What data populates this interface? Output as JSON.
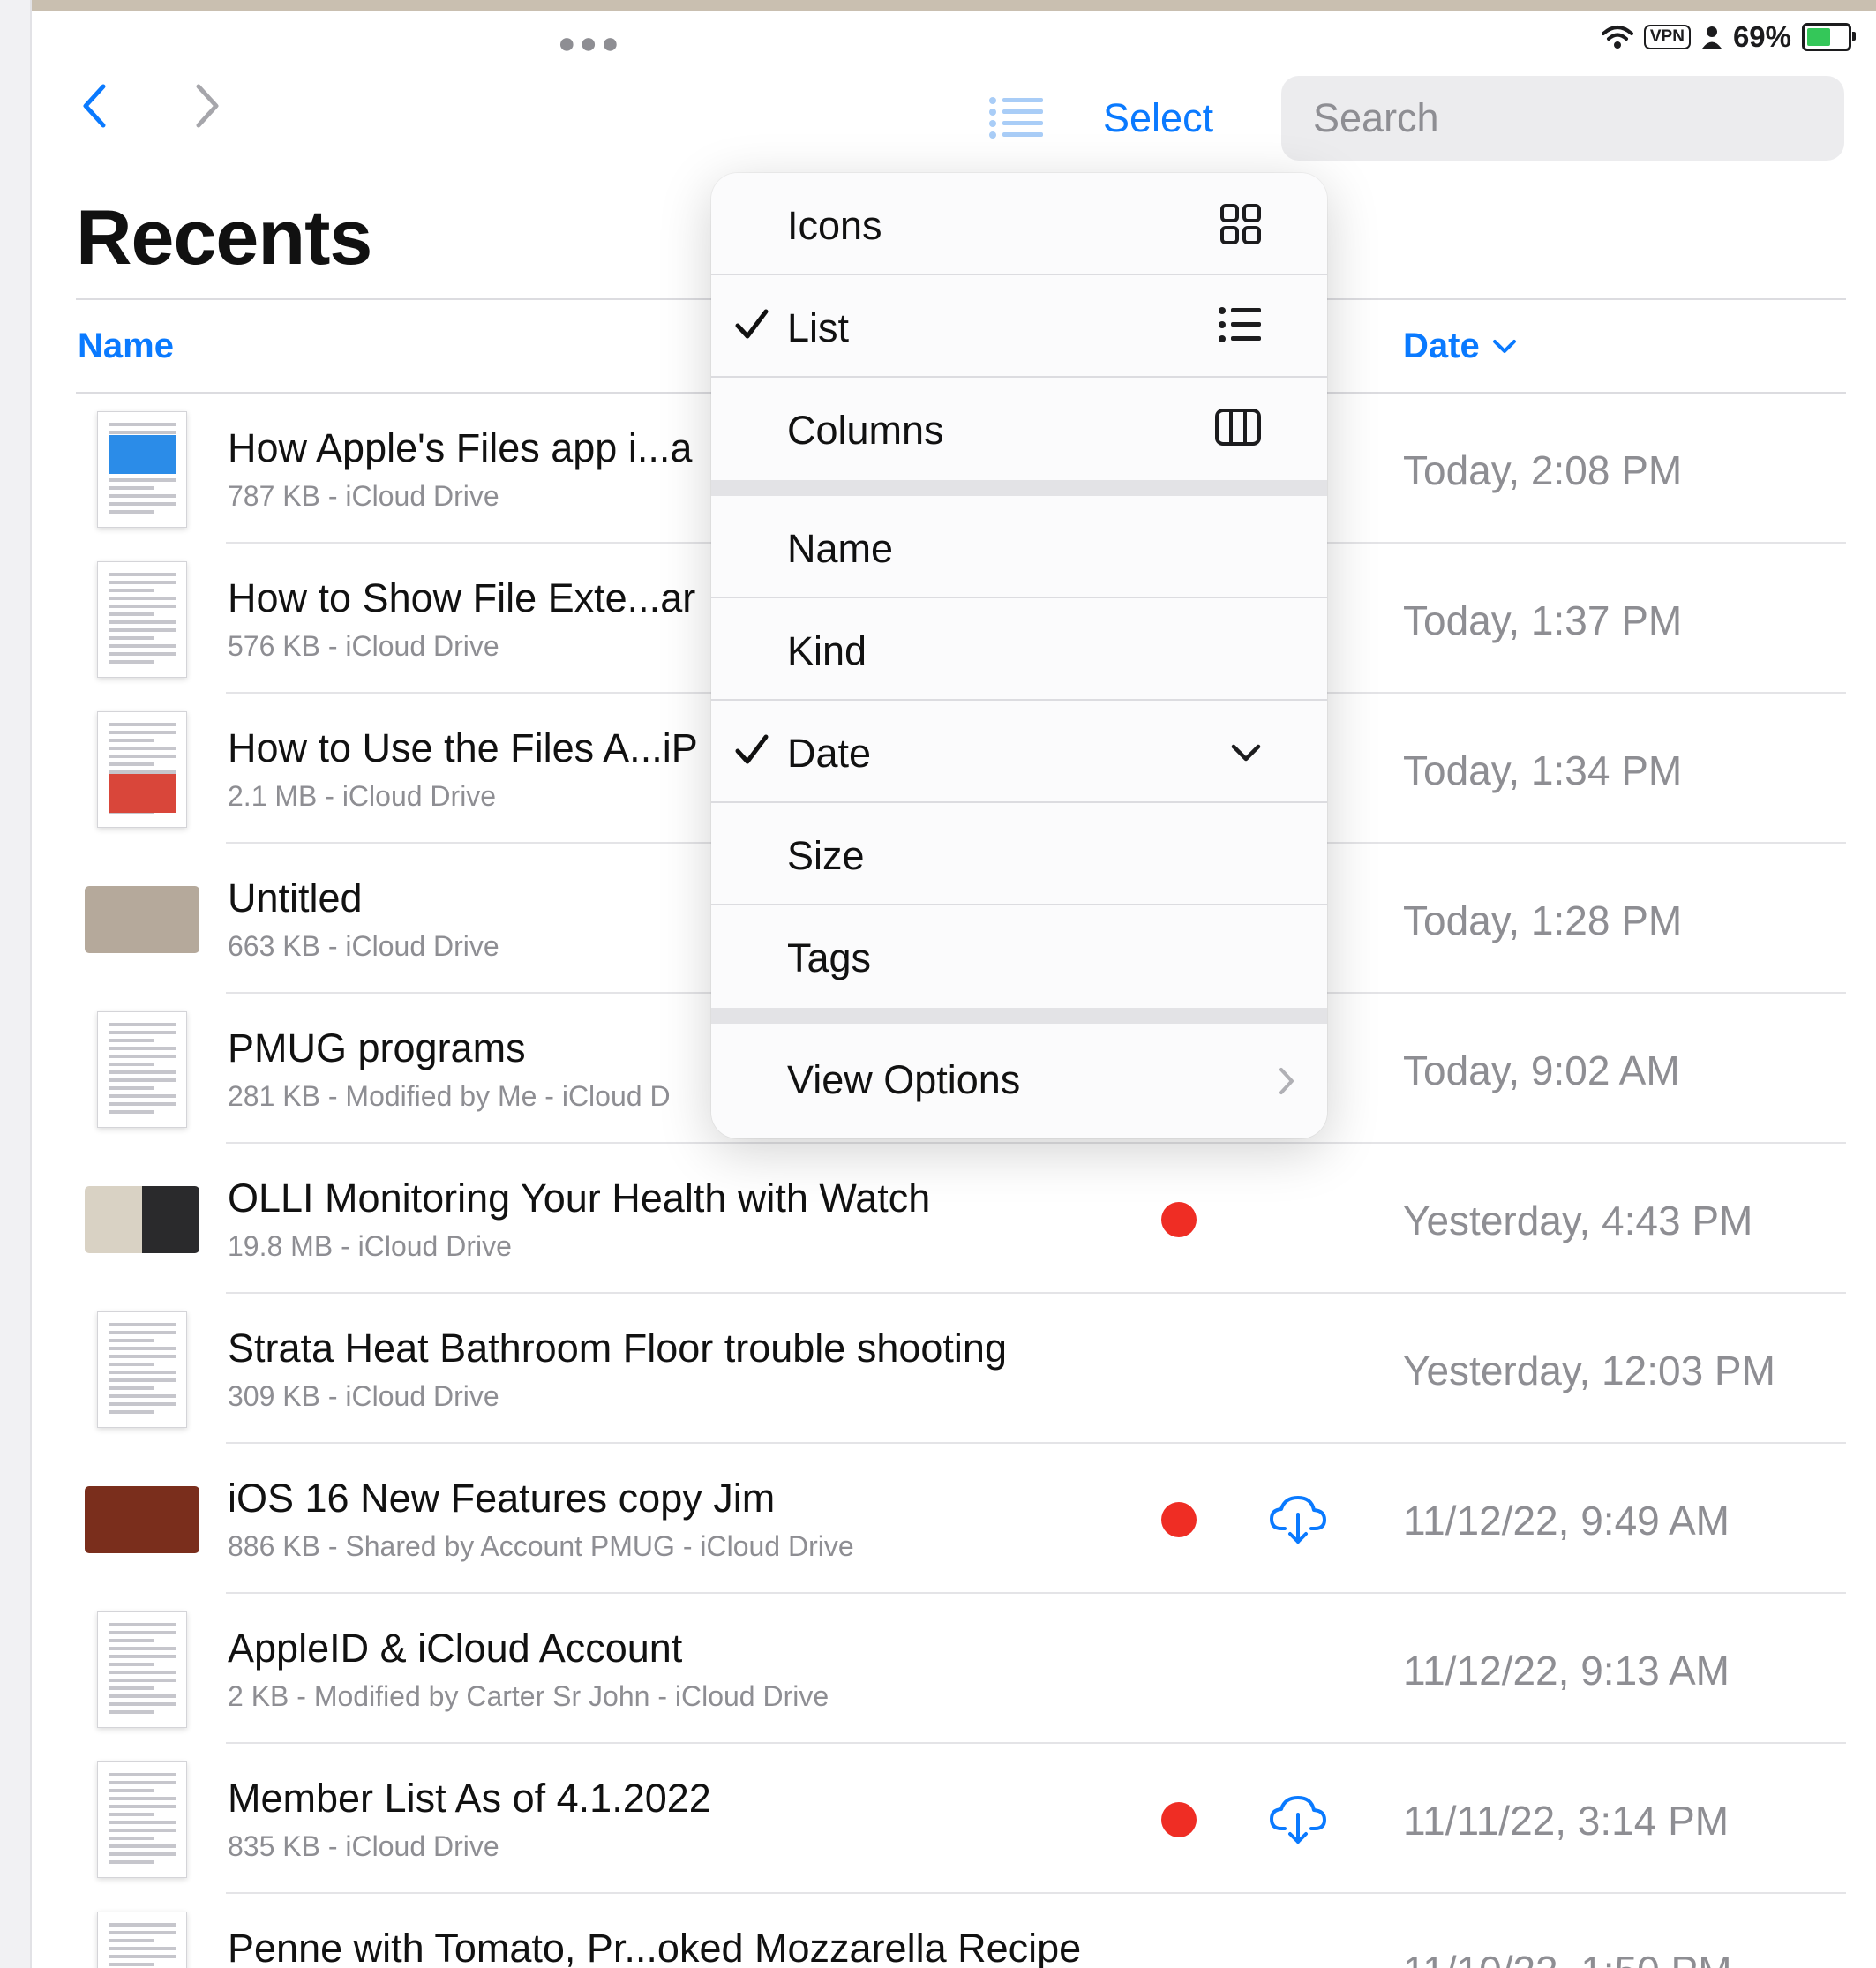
{
  "status_bar": {
    "battery": "69%",
    "vpn": "VPN",
    "battery_level": 0.69
  },
  "toolbar": {
    "select_label": "Select",
    "search_placeholder": "Search"
  },
  "page": {
    "title": "Recents"
  },
  "columns": {
    "name": "Name",
    "date": "Date"
  },
  "menu": {
    "view_items": [
      {
        "label": "Icons",
        "checked": false,
        "icon": "grid-icon"
      },
      {
        "label": "List",
        "checked": true,
        "icon": "list-icon"
      },
      {
        "label": "Columns",
        "checked": false,
        "icon": "columns-icon"
      }
    ],
    "sort_items": [
      {
        "label": "Name",
        "checked": false
      },
      {
        "label": "Kind",
        "checked": false
      },
      {
        "label": "Date",
        "checked": true,
        "icon": "chevron-down-icon"
      },
      {
        "label": "Size",
        "checked": false
      },
      {
        "label": "Tags",
        "checked": false
      }
    ],
    "view_options": {
      "label": "View Options",
      "icon": "chevron-right-icon"
    }
  },
  "files": [
    {
      "title": "How Apple's Files app i...a",
      "subtitle": "787 KB - iCloud Drive",
      "date": "Today, 2:08 PM",
      "tag": false,
      "download": false,
      "thumb": "doc-blue"
    },
    {
      "title": "How to Show File Exte...ar",
      "subtitle": "576 KB - iCloud Drive",
      "date": "Today, 1:37 PM",
      "tag": false,
      "download": false,
      "thumb": "doc"
    },
    {
      "title": "How to Use the Files A...iP",
      "subtitle": "2.1 MB - iCloud Drive",
      "date": "Today, 1:34 PM",
      "tag": false,
      "download": false,
      "thumb": "doc-red"
    },
    {
      "title": "Untitled",
      "subtitle": "663 KB - iCloud Drive",
      "date": "Today, 1:28 PM",
      "tag": false,
      "download": false,
      "thumb": "slide-tan"
    },
    {
      "title": "PMUG programs",
      "subtitle": "281 KB - Modified by Me - iCloud D",
      "date": "Today, 9:02 AM",
      "tag": false,
      "download": false,
      "thumb": "doc"
    },
    {
      "title": "OLLI Monitoring Your Health with Watch",
      "subtitle": "19.8 MB - iCloud Drive",
      "date": "Yesterday, 4:43 PM",
      "tag": true,
      "download": false,
      "thumb": "slide-dark"
    },
    {
      "title": "Strata Heat Bathroom Floor trouble shooting",
      "subtitle": "309 KB - iCloud Drive",
      "date": "Yesterday, 12:03 PM",
      "tag": false,
      "download": false,
      "thumb": "doc"
    },
    {
      "title": "iOS 16 New Features copy Jim",
      "subtitle": "886 KB - Shared by Account PMUG - iCloud Drive",
      "date": "11/12/22, 9:49 AM",
      "tag": true,
      "download": true,
      "thumb": "slide-brown"
    },
    {
      "title": "AppleID & iCloud Account",
      "subtitle": "2 KB - Modified by Carter Sr John - iCloud Drive",
      "date": "11/12/22, 9:13 AM",
      "tag": false,
      "download": false,
      "thumb": "doc"
    },
    {
      "title": "Member List As of 4.1.2022",
      "subtitle": "835 KB - iCloud Drive",
      "date": "11/11/22, 3:14 PM",
      "tag": true,
      "download": true,
      "thumb": "doc-grid"
    },
    {
      "title": "Penne with Tomato, Pr...oked Mozzarella Recipe",
      "subtitle": "",
      "date": "11/10/22, 1:50 PM",
      "tag": false,
      "download": false,
      "thumb": "doc"
    }
  ],
  "colors": {
    "accent": "#0a7aff",
    "tag_red": "#ef2d24",
    "secondary_text": "#8e8e93"
  }
}
